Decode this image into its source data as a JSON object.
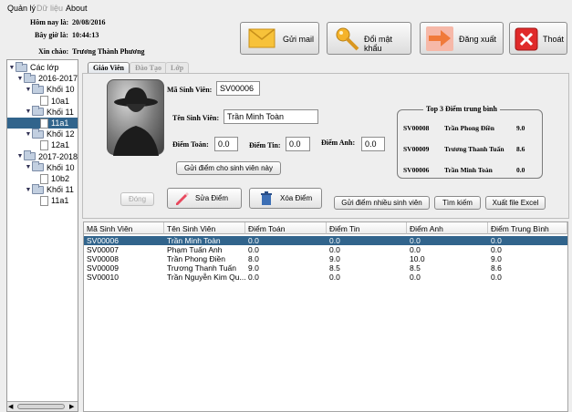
{
  "menu": [
    "Quản lý",
    "Dữ liệu",
    "About"
  ],
  "header": {
    "date_label": "Hôm nay là:",
    "date_value": "20/08/2016",
    "time_label": "Bây giờ là:",
    "time_value": "10:44:13",
    "greeting_label": "Xin chào:",
    "greeting_value": "Trương Thành Phương",
    "buttons": {
      "mail": "Gửi mail",
      "password": "Đổi mật khẩu",
      "logout": "Đăng xuất",
      "exit": "Thoát"
    }
  },
  "tree": [
    {
      "label": "Các lớp",
      "level": 0,
      "type": "folder",
      "expanded": true
    },
    {
      "label": "2016-2017",
      "level": 1,
      "type": "folder",
      "expanded": true
    },
    {
      "label": "Khối 10",
      "level": 2,
      "type": "folder",
      "expanded": true
    },
    {
      "label": "10a1",
      "level": 3,
      "type": "file"
    },
    {
      "label": "Khối 11",
      "level": 2,
      "type": "folder",
      "expanded": true
    },
    {
      "label": "11a1",
      "level": 3,
      "type": "file",
      "selected": true
    },
    {
      "label": "Khối 12",
      "level": 2,
      "type": "folder",
      "expanded": true
    },
    {
      "label": "12a1",
      "level": 3,
      "type": "file"
    },
    {
      "label": "2017-2018",
      "level": 1,
      "type": "folder",
      "expanded": true
    },
    {
      "label": "Khối 10",
      "level": 2,
      "type": "folder",
      "expanded": true
    },
    {
      "label": "10b2",
      "level": 3,
      "type": "file"
    },
    {
      "label": "Khối 11",
      "level": 2,
      "type": "folder",
      "expanded": true
    },
    {
      "label": "11a1",
      "level": 3,
      "type": "file"
    }
  ],
  "tabs": [
    "Giáo Viên",
    "Đào Tạo",
    "Lớp"
  ],
  "form": {
    "student_id_label": "Mã Sinh Viên:",
    "student_id": "SV00006",
    "student_name_label": "Tên Sinh Viên:",
    "student_name": "Trần Minh Toàn",
    "math_label": "Điểm Toán:",
    "math": "0.0",
    "it_label": "Điểm Tin:",
    "it": "0.0",
    "english_label": "Điểm Anh:",
    "english": "0.0",
    "send_one": "Gửi điểm cho sinh viên này"
  },
  "top3": {
    "title": "Top 3 Điểm trung bình",
    "rows": [
      {
        "id": "SV00008",
        "name": "Trần Phong Điền",
        "avg": "9.0"
      },
      {
        "id": "SV00009",
        "name": "Trương Thanh Tuấn",
        "avg": "8.6"
      },
      {
        "id": "SV00006",
        "name": "Trần Minh Toàn",
        "avg": "0.0"
      }
    ]
  },
  "actions": {
    "close": "Đóng",
    "edit": "Sửa Điểm",
    "delete": "Xóa Điểm",
    "send_many": "Gửi điểm nhiều sinh viên",
    "search": "Tìm kiếm",
    "export": "Xuất file Excel"
  },
  "table": {
    "headers": [
      "Mã Sinh Viên",
      "Tên Sinh Viên",
      "Điểm Toán",
      "Điểm Tin",
      "Điểm Anh",
      "Điểm Trung Bình"
    ],
    "rows": [
      [
        "SV00006",
        "Trần Minh Toàn",
        "0.0",
        "0.0",
        "0.0",
        "0.0"
      ],
      [
        "SV00007",
        "Phạm Tuấn Anh",
        "0.0",
        "0.0",
        "0.0",
        "0.0"
      ],
      [
        "SV00008",
        "Trần Phong Điền",
        "8.0",
        "9.0",
        "10.0",
        "9.0"
      ],
      [
        "SV00009",
        "Trương Thanh Tuấn",
        "9.0",
        "8.5",
        "8.5",
        "8.6"
      ],
      [
        "SV00010",
        "Trần Nguyễn Kim Qu...",
        "0.0",
        "0.0",
        "0.0",
        "0.0"
      ]
    ],
    "selected_row": 0
  },
  "colors": {
    "selection": "#31648c",
    "logout_bg": "#f6b8a8",
    "arrow": "#f07a3a",
    "exit_red": "#e02a2a"
  }
}
